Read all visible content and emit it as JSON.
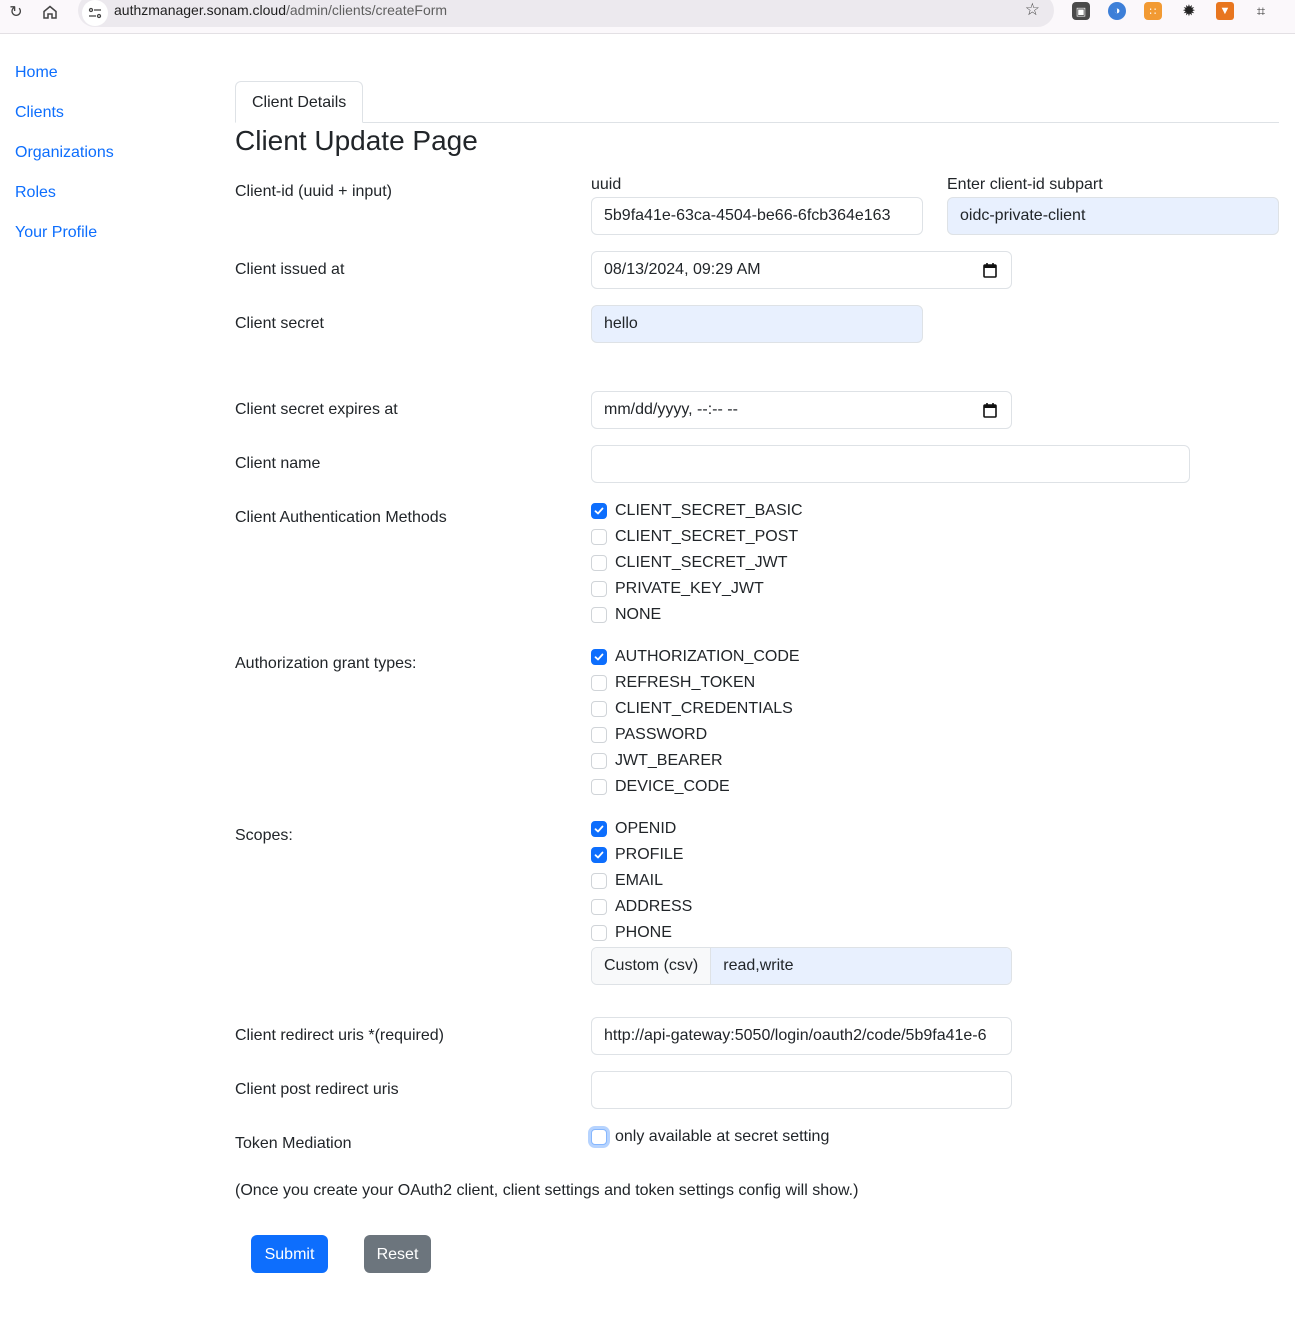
{
  "browser": {
    "url_host": "authzmanager.sonam.cloud",
    "url_path": "/admin/clients/createForm",
    "extensions": [
      "extension-1-icon",
      "extension-2-icon",
      "extension-3-icon",
      "extension-4-icon",
      "metamask-fox-icon",
      "extensions-puzzle-icon"
    ]
  },
  "sidebar": {
    "items": [
      {
        "label": "Home"
      },
      {
        "label": "Clients"
      },
      {
        "label": "Organizations"
      },
      {
        "label": "Roles"
      },
      {
        "label": "Your Profile"
      }
    ]
  },
  "tabs": [
    {
      "label": "Client Details",
      "active": true
    }
  ],
  "page_title": "Client Update Page",
  "form": {
    "client_id": {
      "label": "Client-id (uuid + input)",
      "uuid_label": "uuid",
      "uuid_value": "5b9fa41e-63ca-4504-be66-6fcb364e163",
      "subpart_label": "Enter client-id subpart",
      "subpart_value": "oidc-private-client"
    },
    "issued_at": {
      "label": "Client issued at",
      "value": "08/13/2024, 09:29 AM"
    },
    "secret": {
      "label": "Client secret",
      "value": "hello"
    },
    "secret_expires_at": {
      "label": "Client secret expires at",
      "placeholder": "mm/dd/yyyy, --:-- --"
    },
    "client_name": {
      "label": "Client name",
      "value": ""
    },
    "auth_methods": {
      "label": "Client Authentication Methods",
      "options": [
        {
          "label": "CLIENT_SECRET_BASIC",
          "checked": true
        },
        {
          "label": "CLIENT_SECRET_POST",
          "checked": false
        },
        {
          "label": "CLIENT_SECRET_JWT",
          "checked": false
        },
        {
          "label": "PRIVATE_KEY_JWT",
          "checked": false
        },
        {
          "label": "NONE",
          "checked": false
        }
      ]
    },
    "grant_types": {
      "label": "Authorization grant types:",
      "options": [
        {
          "label": "AUTHORIZATION_CODE",
          "checked": true
        },
        {
          "label": "REFRESH_TOKEN",
          "checked": false
        },
        {
          "label": "CLIENT_CREDENTIALS",
          "checked": false
        },
        {
          "label": "PASSWORD",
          "checked": false
        },
        {
          "label": "JWT_BEARER",
          "checked": false
        },
        {
          "label": "DEVICE_CODE",
          "checked": false
        }
      ]
    },
    "scopes": {
      "label": "Scopes:",
      "options": [
        {
          "label": "OPENID",
          "checked": true
        },
        {
          "label": "PROFILE",
          "checked": true
        },
        {
          "label": "EMAIL",
          "checked": false
        },
        {
          "label": "ADDRESS",
          "checked": false
        },
        {
          "label": "PHONE",
          "checked": false
        }
      ],
      "custom_addon": "Custom (csv)",
      "custom_value": "read,write"
    },
    "redirect_uris": {
      "label": "Client redirect uris *(required)",
      "value": "http://api-gateway:5050/login/oauth2/code/5b9fa41e-6"
    },
    "post_redirect_uris": {
      "label": "Client post redirect uris",
      "value": ""
    },
    "token_mediation": {
      "label": "Token Mediation",
      "checkbox_label": "only available at secret setting",
      "checked": false
    }
  },
  "note": "(Once you create your OAuth2 client, client settings and token settings config will show.)",
  "buttons": {
    "submit": "Submit",
    "reset": "Reset"
  },
  "colors": {
    "primary": "#0d6efd",
    "secondary": "#6c757d",
    "autofill": "#e8f0fe"
  }
}
